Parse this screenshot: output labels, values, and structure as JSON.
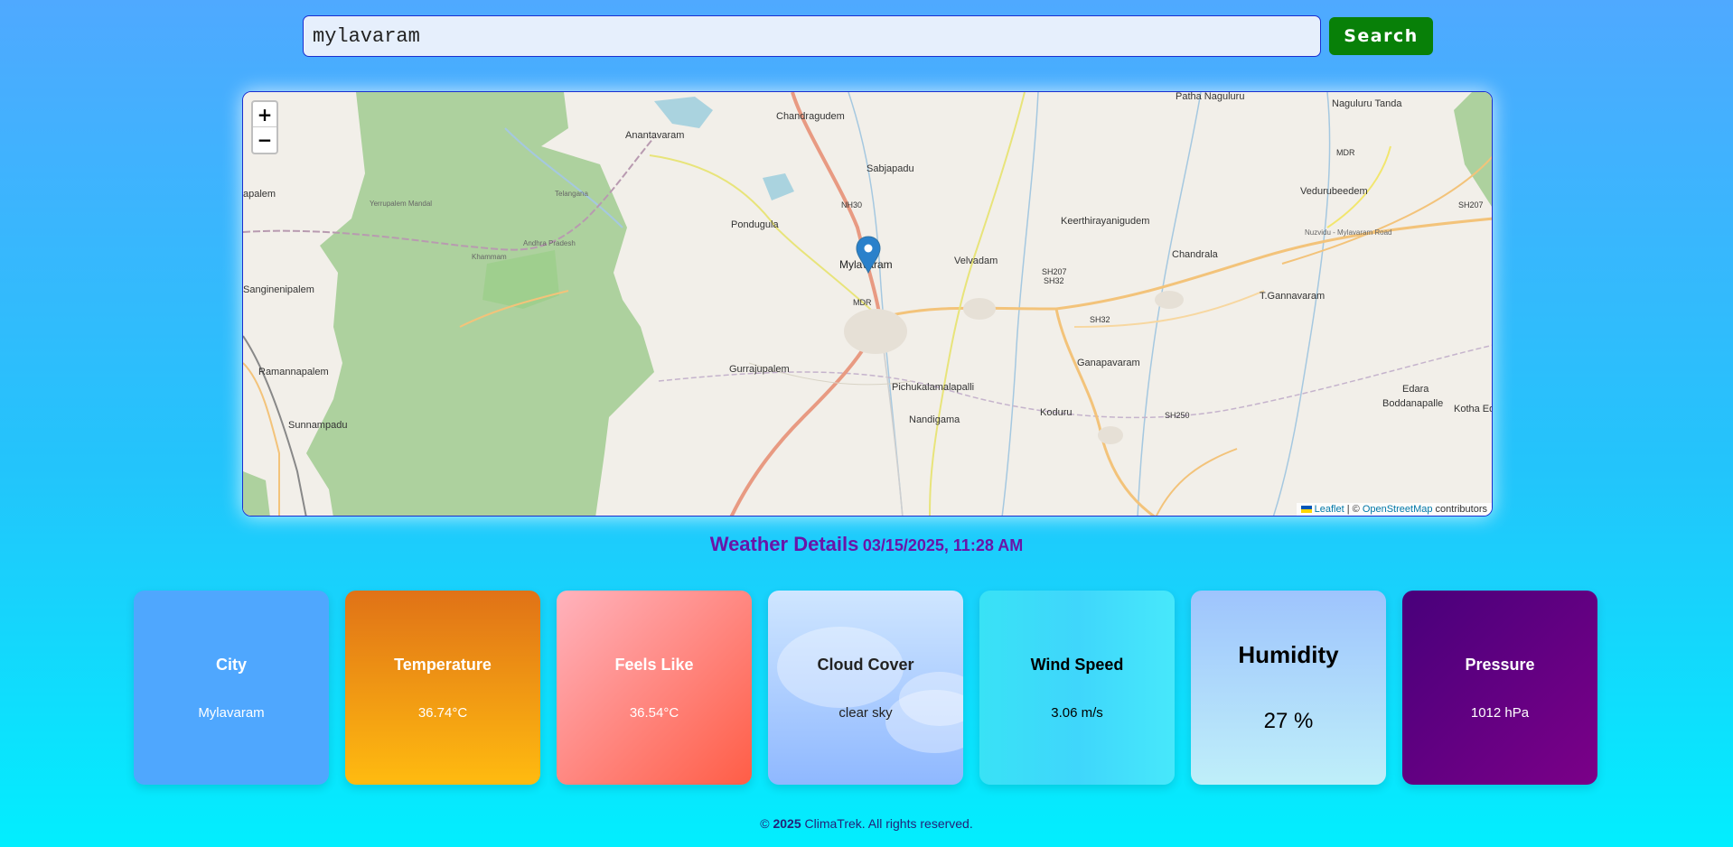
{
  "search": {
    "value": "mylavaram",
    "button_label": "Search"
  },
  "map": {
    "zoom_in_label": "+",
    "zoom_out_label": "−",
    "attribution": {
      "leaflet": "Leaflet",
      "sep": " | © ",
      "osm": "OpenStreetMap",
      "contributors": " contributors"
    },
    "places": [
      "Patha Naguluru",
      "Naguluru Tanda",
      "Chandragudem",
      "Anantavaram",
      "Sabjapadu",
      "MDR",
      "Vedurubeedem",
      "SH207",
      "Yerrupalem Mandal",
      "Pondugula",
      "NH30",
      "Keerthirayanigudem",
      "Nuzvidu - Mylavaram Road",
      "Chandrala",
      "Velvadam",
      "Mylavaram",
      "SH207",
      "SH32",
      "Sanginenipalem",
      "MDR",
      "T.Gannavaram",
      "SH32",
      "Ganapavaram",
      "Gurrajupalem",
      "Ramannapalem",
      "Pichukalamalapalli",
      "Edara",
      "Boddanapalle",
      "Kotha Ed",
      "Nandigama",
      "Koduru",
      "SH250",
      "Sunnampadu",
      "Telangana",
      "Andhra Pradesh",
      "Khammam",
      "apalem"
    ],
    "marker_city": "Mylavaram"
  },
  "heading": {
    "title": "Weather Details",
    "timestamp": "03/15/2025, 11:28 AM"
  },
  "cards": {
    "city": {
      "title": "City",
      "value": "Mylavaram"
    },
    "temperature": {
      "title": "Temperature",
      "value": "36.74°C"
    },
    "feels_like": {
      "title": "Feels Like",
      "value": "36.54°C"
    },
    "cloud_cover": {
      "title": "Cloud Cover",
      "value": "clear sky"
    },
    "wind_speed": {
      "title": "Wind Speed",
      "value": "3.06 m/s"
    },
    "humidity": {
      "title": "Humidity",
      "value": "27 %"
    },
    "pressure": {
      "title": "Pressure",
      "value": "1012 hPa"
    }
  },
  "footer": {
    "copyright": "©",
    "year": "2025",
    "text": "ClimaTrek. All rights reserved."
  },
  "colors": {
    "search_button": "#088008",
    "heading": "#6a15a8",
    "map_border": "#1a2ed0",
    "marker": "#2a81cb"
  }
}
